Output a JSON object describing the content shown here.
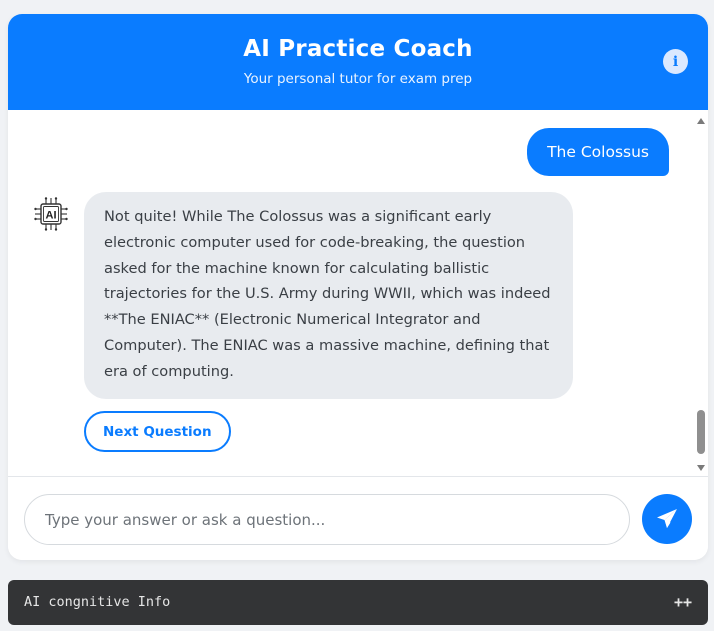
{
  "header": {
    "title": "AI Practice Coach",
    "subtitle": "Your personal tutor for exam prep",
    "info_icon": "info-icon",
    "info_glyph": "i"
  },
  "chat": {
    "user_message": "The Colossus",
    "ai_avatar_label": "AI",
    "ai_message": "Not quite! While The Colossus was a significant early electronic computer used for code-breaking, the question asked for the machine known for calculating ballistic trajectories for the U.S. Army during WWII, which was indeed **The ENIAC** (Electronic Numerical Integrator and Computer). The ENIAC was a massive machine, defining that era of computing.",
    "next_button_label": "Next Question"
  },
  "input": {
    "placeholder": "Type your answer or ask a question...",
    "value": "",
    "send_icon": "paper-plane-icon"
  },
  "info_panel": {
    "label": "AI congnitive Info",
    "toggle_label": "++"
  },
  "colors": {
    "accent": "#0a7cff",
    "ai_bubble": "#e8ebef",
    "panel": "#333436"
  }
}
